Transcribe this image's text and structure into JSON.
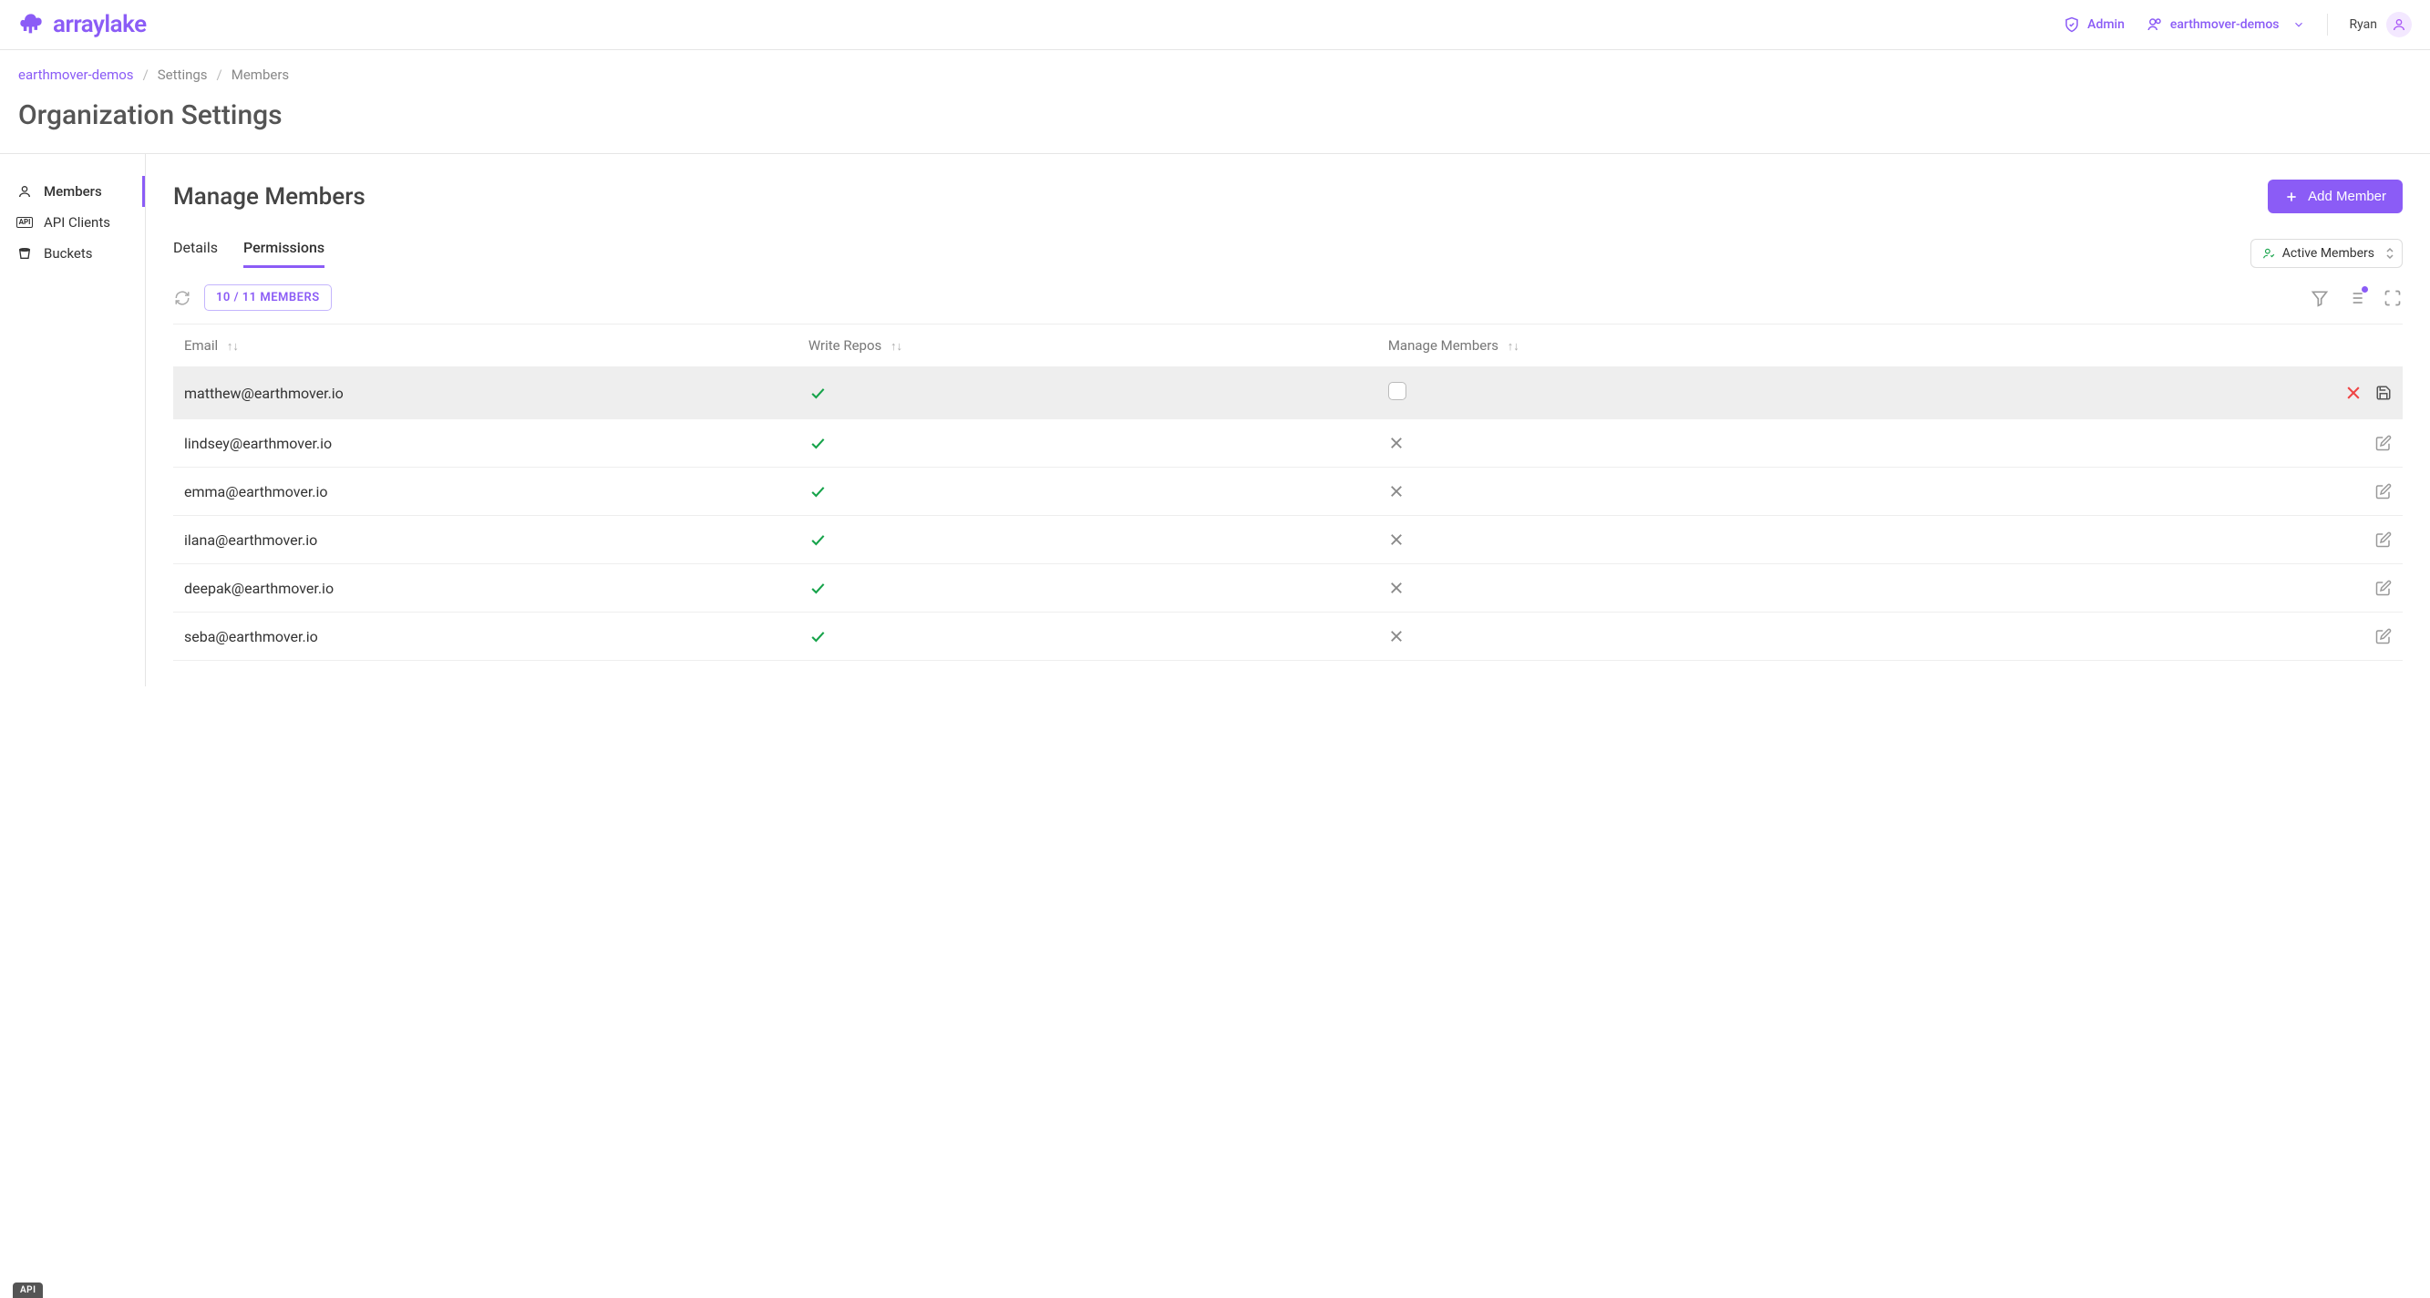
{
  "header": {
    "logo_text": "arraylake",
    "admin_label": "Admin",
    "org_name": "earthmover-demos",
    "user_name": "Ryan"
  },
  "breadcrumb": {
    "org": "earthmover-demos",
    "section": "Settings",
    "page": "Members"
  },
  "page_title": "Organization Settings",
  "sidebar": {
    "items": [
      {
        "label": "Members"
      },
      {
        "label": "API Clients"
      },
      {
        "label": "Buckets"
      }
    ]
  },
  "main": {
    "title": "Manage Members",
    "add_button": "Add Member",
    "tabs": {
      "details": "Details",
      "permissions": "Permissions"
    },
    "filter_select": "Active Members",
    "count_badge": "10 / 11 MEMBERS"
  },
  "table": {
    "headers": {
      "email": "Email",
      "write_repos": "Write Repos",
      "manage_members": "Manage Members"
    },
    "rows": [
      {
        "email": "matthew@earthmover.io",
        "write": true,
        "manage": false,
        "editing": true
      },
      {
        "email": "lindsey@earthmover.io",
        "write": true,
        "manage": false,
        "editing": false
      },
      {
        "email": "emma@earthmover.io",
        "write": true,
        "manage": false,
        "editing": false
      },
      {
        "email": "ilana@earthmover.io",
        "write": true,
        "manage": false,
        "editing": false
      },
      {
        "email": "deepak@earthmover.io",
        "write": true,
        "manage": false,
        "editing": false
      },
      {
        "email": "seba@earthmover.io",
        "write": true,
        "manage": false,
        "editing": false
      }
    ]
  },
  "float_label": "API"
}
